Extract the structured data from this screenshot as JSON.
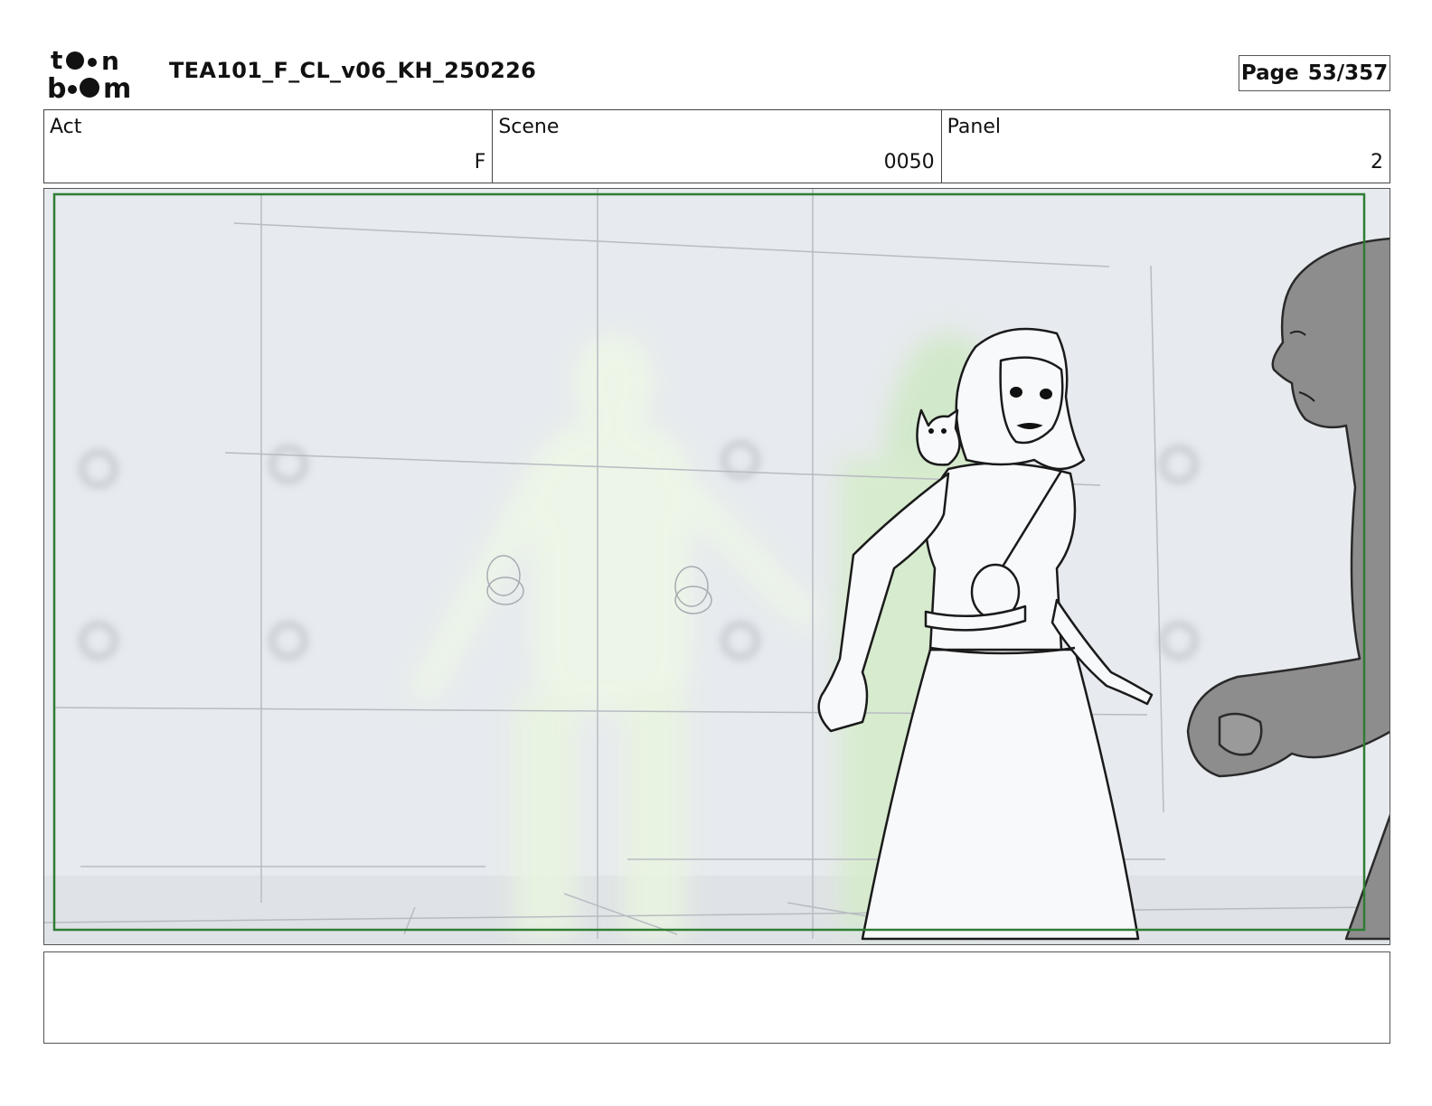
{
  "header": {
    "logo_text": "toon boom",
    "doc_title": "TEA101_F_CL_v06_KH_250226",
    "page_label": "Page",
    "page_number": "53/357"
  },
  "fields": {
    "act": {
      "label": "Act",
      "value": "F"
    },
    "scene": {
      "label": "Scene",
      "value": "0050"
    },
    "panel": {
      "label": "Panel",
      "value": "2"
    }
  },
  "panel_image": {
    "safe_frame_color": "#2e7d32",
    "glow_color": "#d8f0c8"
  },
  "notes": {
    "text": ""
  }
}
